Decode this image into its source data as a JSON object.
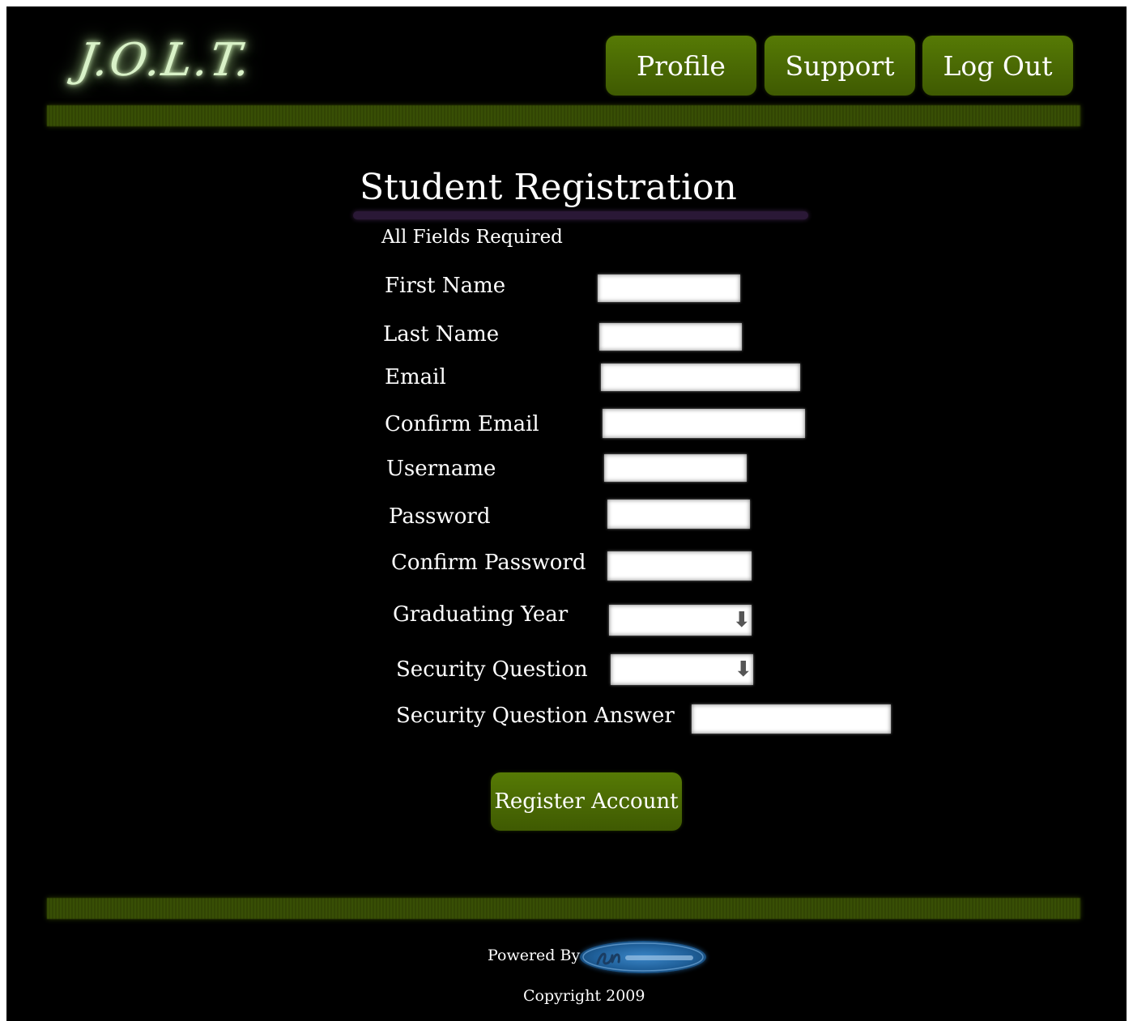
{
  "header": {
    "logo_text": "J.O.L.T.",
    "nav": {
      "profile": "Profile",
      "support": "Support",
      "logout": "Log Out"
    }
  },
  "form": {
    "title": "Student Registration",
    "subtitle": "All Fields Required",
    "fields": {
      "first_name": "First Name",
      "last_name": "Last Name",
      "email": "Email",
      "confirm_email": "Confirm Email",
      "username": "Username",
      "password": "Password",
      "confirm_password": "Confirm Password",
      "graduating_year": "Graduating Year",
      "security_question": "Security Question",
      "security_answer": "Security Question Answer"
    },
    "submit_label": "Register Account"
  },
  "footer": {
    "powered_by": "Powered By",
    "copyright": "Copyright 2009"
  },
  "colors": {
    "background": "#000000",
    "accent_green": "#4a6a03",
    "text": "#ffffff",
    "underline_purple": "#2a1836"
  },
  "icons": {
    "select_arrow": "arrow-down-icon",
    "brand_logo": "brand-logo-icon"
  }
}
